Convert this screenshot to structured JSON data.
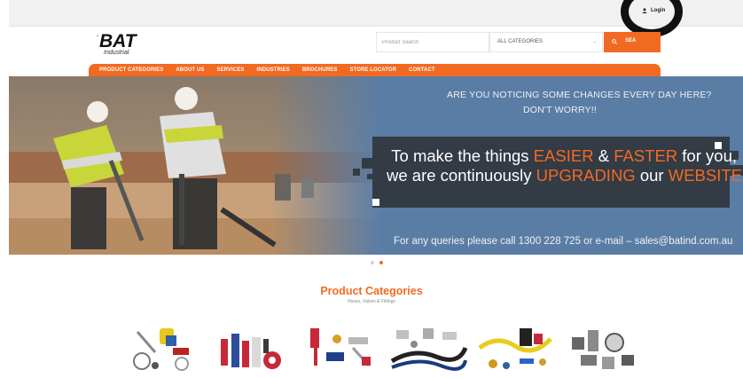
{
  "topbar": {
    "login_label": "Login"
  },
  "brand": {
    "logo_text": "BAT",
    "logo_sub": "Industrial"
  },
  "search": {
    "placeholder": "Product Search",
    "category_value": "ALL CATEGORIES",
    "button_label": "SEA"
  },
  "nav": {
    "items": [
      "PRODUCT CATEGORIES",
      "ABOUT US",
      "SERVICES",
      "INDUSTRIES",
      "BROCHURES",
      "STORE LOCATOR",
      "CONTACT"
    ]
  },
  "hero": {
    "line1": "ARE YOU NOTICING SOME CHANGES EVERY DAY HERE?",
    "line2": "DON'T WORRY!!",
    "msg": {
      "p1": "To make the things ",
      "easier": "EASIER",
      "amp": " & ",
      "faster": "FASTER",
      "p2": " for you,",
      "p3": "we are continuously ",
      "upgrading": "UPGRADING",
      "p4": " our ",
      "website": "WEBSITE",
      "p5": "."
    },
    "contact": "For any queries please call 1300 228 725 or e-mail – sales@batind.com.au"
  },
  "carousel": {
    "slides": 2,
    "active": 2
  },
  "categories": {
    "title": "Product Categories",
    "subtitle": "Hoses, Valves & Fittings"
  },
  "colors": {
    "accent": "#f26a21",
    "hero_bg": "#5a7da6",
    "box": "#333b45"
  }
}
